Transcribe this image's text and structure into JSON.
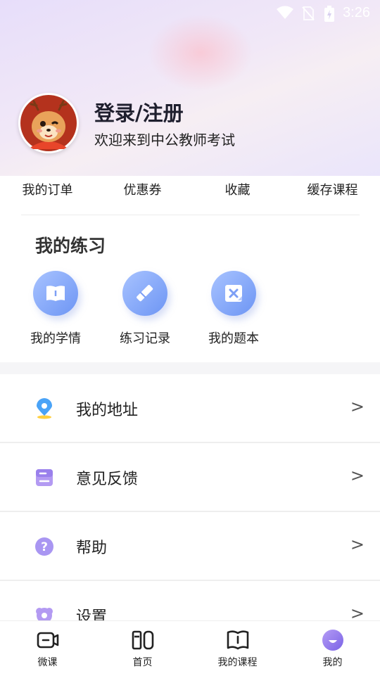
{
  "status_bar": {
    "time": "3:26"
  },
  "profile": {
    "title": "登录/注册",
    "subtitle": "欢迎来到中公教师考试"
  },
  "quick_links": [
    {
      "label": "我的订单"
    },
    {
      "label": "优惠券"
    },
    {
      "label": "收藏"
    },
    {
      "label": "缓存课程"
    }
  ],
  "practice": {
    "title": "我的练习",
    "items": [
      {
        "label": "我的学情",
        "icon": "book-open-icon"
      },
      {
        "label": "练习记录",
        "icon": "pencil-icon"
      },
      {
        "label": "我的题本",
        "icon": "wrong-question-icon"
      }
    ]
  },
  "menu": [
    {
      "label": "我的地址",
      "icon": "location-pin-icon",
      "arrow": ">"
    },
    {
      "label": "意见反馈",
      "icon": "feedback-box-icon",
      "arrow": ">"
    },
    {
      "label": "帮助",
      "icon": "help-icon",
      "arrow": ">"
    },
    {
      "label": "设置",
      "icon": "settings-icon",
      "arrow": ">"
    }
  ],
  "tabbar": [
    {
      "label": "微课",
      "icon": "video-camera-icon"
    },
    {
      "label": "首页",
      "icon": "home-grid-icon"
    },
    {
      "label": "我的课程",
      "icon": "course-book-icon"
    },
    {
      "label": "我的",
      "icon": "profile-icon",
      "active": true
    }
  ],
  "colors": {
    "accent_blue": "#6d95f4",
    "accent_purple": "#9b8cf0",
    "header_gradient_start": "#e7defa"
  }
}
